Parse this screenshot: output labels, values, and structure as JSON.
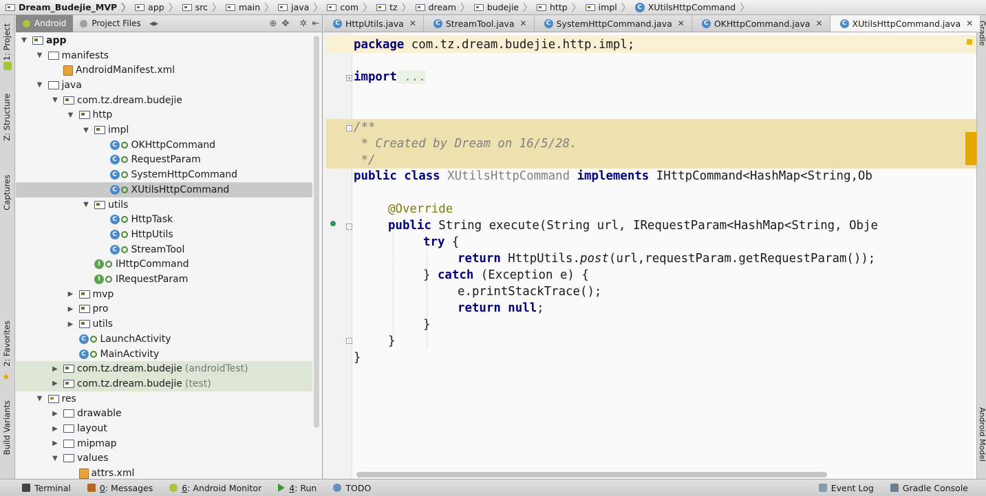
{
  "breadcrumb": [
    {
      "label": "Dream_Budejie_MVP",
      "icon": "module-folder-icon"
    },
    {
      "label": "app",
      "icon": "module-folder-icon"
    },
    {
      "label": "src",
      "icon": "folder-icon"
    },
    {
      "label": "main",
      "icon": "folder-icon"
    },
    {
      "label": "java",
      "icon": "folder-icon"
    },
    {
      "label": "com",
      "icon": "package-icon"
    },
    {
      "label": "tz",
      "icon": "package-icon"
    },
    {
      "label": "dream",
      "icon": "package-icon"
    },
    {
      "label": "budejie",
      "icon": "package-icon"
    },
    {
      "label": "http",
      "icon": "package-icon"
    },
    {
      "label": "impl",
      "icon": "package-icon"
    },
    {
      "label": "XUtilsHttpCommand",
      "icon": "class-icon"
    }
  ],
  "left_strip": {
    "project": "1: Project",
    "structure": "Z: Structure",
    "captures": "Captures",
    "favorites": "2: Favorites",
    "build_variants": "Build Variants"
  },
  "right_strip": {
    "gradle": "Gradle",
    "android_model": "Android Model"
  },
  "project_panel": {
    "tab_android": "Android",
    "tab_project_files": "Project Files",
    "tree": [
      {
        "label": "app",
        "depth": 0,
        "arrow": "▼",
        "icon": "module",
        "bold": true
      },
      {
        "label": "manifests",
        "depth": 1,
        "arrow": "▼",
        "icon": "folder"
      },
      {
        "label": "AndroidManifest.xml",
        "depth": 2,
        "arrow": "",
        "icon": "xml"
      },
      {
        "label": "java",
        "depth": 1,
        "arrow": "▼",
        "icon": "folder"
      },
      {
        "label": "com.tz.dream.budejie",
        "depth": 2,
        "arrow": "▼",
        "icon": "package"
      },
      {
        "label": "http",
        "depth": 3,
        "arrow": "▼",
        "icon": "package"
      },
      {
        "label": "impl",
        "depth": 4,
        "arrow": "▼",
        "icon": "package"
      },
      {
        "label": "OKHttpCommand",
        "depth": 5,
        "arrow": "",
        "icon": "class"
      },
      {
        "label": "RequestParam",
        "depth": 5,
        "arrow": "",
        "icon": "class"
      },
      {
        "label": "SystemHttpCommand",
        "depth": 5,
        "arrow": "",
        "icon": "class"
      },
      {
        "label": "XUtilsHttpCommand",
        "depth": 5,
        "arrow": "",
        "icon": "class",
        "selected": true
      },
      {
        "label": "utils",
        "depth": 4,
        "arrow": "▼",
        "icon": "package"
      },
      {
        "label": "HttpTask",
        "depth": 5,
        "arrow": "",
        "icon": "class"
      },
      {
        "label": "HttpUtils",
        "depth": 5,
        "arrow": "",
        "icon": "class"
      },
      {
        "label": "StreamTool",
        "depth": 5,
        "arrow": "",
        "icon": "class"
      },
      {
        "label": "IHttpCommand",
        "depth": 4,
        "arrow": "",
        "icon": "interface"
      },
      {
        "label": "IRequestParam",
        "depth": 4,
        "arrow": "",
        "icon": "interface"
      },
      {
        "label": "mvp",
        "depth": 3,
        "arrow": "▶",
        "icon": "package"
      },
      {
        "label": "pro",
        "depth": 3,
        "arrow": "▶",
        "icon": "package"
      },
      {
        "label": "utils",
        "depth": 3,
        "arrow": "▶",
        "icon": "package"
      },
      {
        "label": "LaunchActivity",
        "depth": 3,
        "arrow": "",
        "icon": "class"
      },
      {
        "label": "MainActivity",
        "depth": 3,
        "arrow": "",
        "icon": "class"
      },
      {
        "label": "com.tz.dream.budejie",
        "suffix": "(androidTest)",
        "depth": 2,
        "arrow": "▶",
        "icon": "package",
        "highlight": true
      },
      {
        "label": "com.tz.dream.budejie",
        "suffix": "(test)",
        "depth": 2,
        "arrow": "▶",
        "icon": "package",
        "highlight": true
      },
      {
        "label": "res",
        "depth": 1,
        "arrow": "▼",
        "icon": "res"
      },
      {
        "label": "drawable",
        "depth": 2,
        "arrow": "▶",
        "icon": "folder"
      },
      {
        "label": "layout",
        "depth": 2,
        "arrow": "▶",
        "icon": "folder"
      },
      {
        "label": "mipmap",
        "depth": 2,
        "arrow": "▶",
        "icon": "folder"
      },
      {
        "label": "values",
        "depth": 2,
        "arrow": "▼",
        "icon": "folder"
      },
      {
        "label": "attrs.xml",
        "depth": 3,
        "arrow": "",
        "icon": "xml"
      }
    ]
  },
  "editor_tabs": [
    {
      "label": "HttpUtils.java",
      "active": false
    },
    {
      "label": "StreamTool.java",
      "active": false
    },
    {
      "label": "SystemHttpCommand.java",
      "active": false
    },
    {
      "label": "OKHttpCommand.java",
      "active": false
    },
    {
      "label": "XUtilsHttpCommand.java",
      "active": true
    }
  ],
  "editor_tabs_more": "⁵",
  "code": {
    "package_kw": "package",
    "package_name": " com.tz.dream.budejie.http.impl;",
    "import_kw": "import",
    "import_rest": " ...",
    "comment1": "/**",
    "comment2": " * Created by Dream on 16/5/28.",
    "comment3": " */",
    "class_mod": "public class",
    "class_name": " XUtilsHttpCommand ",
    "implements_kw": "implements",
    "class_rest": " IHttpCommand<HashMap<String,Ob",
    "override": "@Override",
    "method_mod": "public",
    "method_sig": " String execute(String url, IRequestParam<HashMap<String, Obje",
    "try_kw": "try",
    "try_rest": " {",
    "return_kw": "return",
    "return_rest": " HttpUtils.",
    "return_post": "post",
    "return_args": "(url,requestParam.getRequestParam());",
    "catch_open": "} ",
    "catch_kw": "catch",
    "catch_rest": " (Exception e) {",
    "print_line": "e.printStackTrace();",
    "return_null_kw": "return null",
    "return_null_rest": ";",
    "close1": "}",
    "close2": "}",
    "close3": "}"
  },
  "status_bar": {
    "terminal": "Terminal",
    "messages_num": "0",
    "messages": ": Messages",
    "monitor_num": "6",
    "monitor": ": Android Monitor",
    "run_num": "4",
    "run": ": Run",
    "todo": "TODO",
    "event_log": "Event Log",
    "gradle_console": "Gradle Console"
  }
}
